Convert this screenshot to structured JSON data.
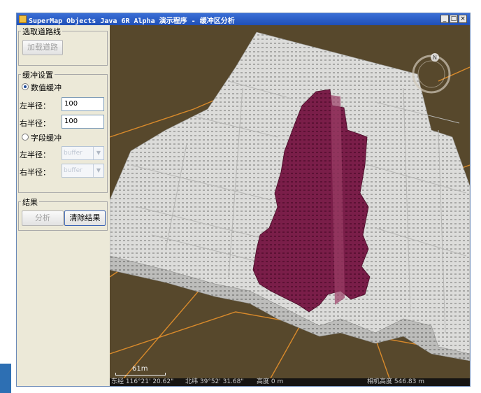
{
  "window": {
    "title": "SuperMap Objects Java 6R Alpha 演示程序 - 缓冲区分析",
    "minimize_glyph": "_",
    "maximize_glyph": "□",
    "close_glyph": "×"
  },
  "road_group": {
    "title": "选取道路线",
    "load_button": "加载道路"
  },
  "buffer_group": {
    "title": "缓冲设置",
    "numeric_radio": "数值缓冲",
    "left_radius_label": "左半径：",
    "left_radius_value": "100",
    "right_radius_label": "右半径：",
    "right_radius_value": "100",
    "field_radio": "字段缓冲",
    "field_left_label": "左半径：",
    "field_left_value": "buffer",
    "field_right_label": "右半径：",
    "field_right_value": "buffer"
  },
  "result_group": {
    "title": "结果",
    "analyze_button": "分析",
    "clear_button": "清除结果"
  },
  "scene": {
    "scale_label": "61m",
    "longitude": "东经 116°21' 20.62\"",
    "latitude": "北纬 39°52' 31.68\"",
    "altitude": "高度 0 m",
    "camera_height": "相机高度 546.83 m",
    "compass_letter": "N",
    "ground_color": "#57482c",
    "building_color": "#d6d6d4",
    "buffer_color": "#7a1e49",
    "road_color": "#d98a2b"
  },
  "icons": {
    "app": "app-icon",
    "compass": "compass-icon"
  }
}
